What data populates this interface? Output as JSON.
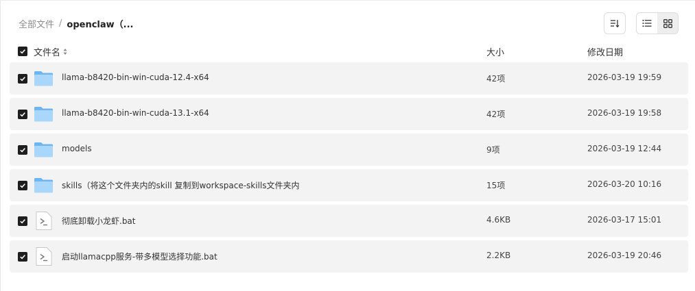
{
  "breadcrumb": {
    "root": "全部文件",
    "separator": "/",
    "current": "openclaw（..."
  },
  "toolbar": {
    "sort_icon": "sort-icon",
    "list_view_icon": "list-view-icon",
    "grid_view_icon": "grid-view-icon",
    "active_view": "grid"
  },
  "table": {
    "columns": {
      "name": "文件名",
      "size": "大小",
      "modified": "修改日期"
    },
    "all_selected": true,
    "rows": [
      {
        "type": "folder",
        "name": "llama-b8420-bin-win-cuda-12.4-x64",
        "size": "42项",
        "modified": "2026-03-19 19:59",
        "selected": true
      },
      {
        "type": "folder",
        "name": "llama-b8420-bin-win-cuda-13.1-x64",
        "size": "42项",
        "modified": "2026-03-19 19:58",
        "selected": true
      },
      {
        "type": "folder",
        "name": "models",
        "size": "9项",
        "modified": "2026-03-19 12:44",
        "selected": true
      },
      {
        "type": "folder",
        "name": "skills（将这个文件夹内的skill 复制到workspace-skills文件夹内",
        "size": "15项",
        "modified": "2026-03-20 10:16",
        "selected": true
      },
      {
        "type": "bat",
        "name": "彻底卸载小龙虾.bat",
        "size": "4.6KB",
        "modified": "2026-03-17 15:01",
        "selected": true
      },
      {
        "type": "bat",
        "name": "启动llamacpp服务-带多模型选择功能.bat",
        "size": "2.2KB",
        "modified": "2026-03-19 20:46",
        "selected": true
      }
    ]
  },
  "colors": {
    "checkbox": "#1e1e1e",
    "row_bg": "#f3f3f3",
    "folder_light": "#a9d6fb",
    "folder_dark": "#6fb5f2"
  }
}
